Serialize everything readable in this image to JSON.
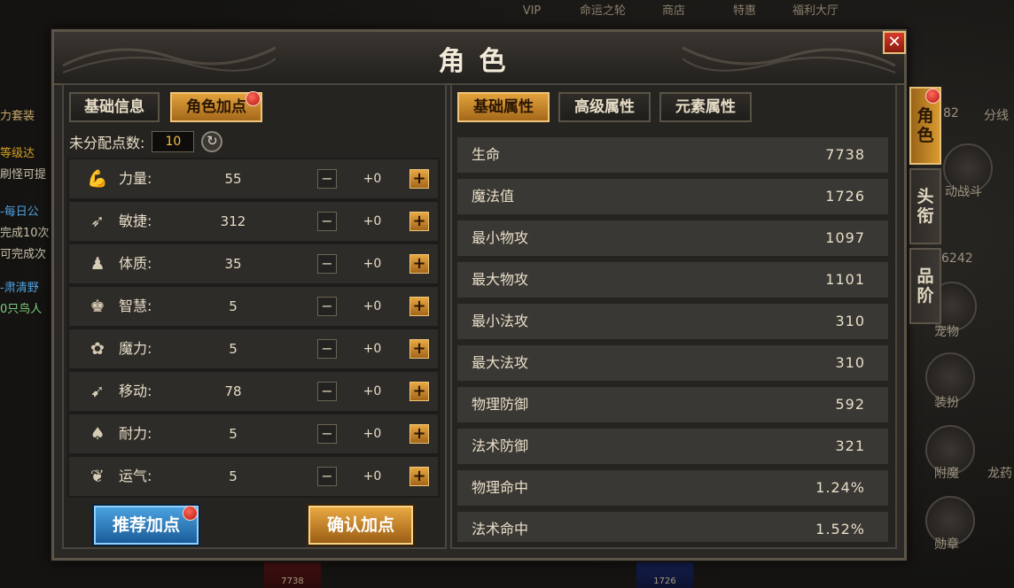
{
  "top_nav": [
    "VIP",
    "命运之轮",
    "商店",
    "特惠",
    "福利大厅"
  ],
  "left_side_texts": [
    {
      "text": "力套装",
      "color": "#c8a86a"
    },
    {
      "text": "等级达",
      "color": "#d4a020"
    },
    {
      "text": "刷怪可提",
      "color": "#c8c0a8"
    },
    {
      "text": "-每日公",
      "color": "#4fa0e0"
    },
    {
      "text": "完成10次",
      "color": "#c8c0a8"
    },
    {
      "text": "可完成次",
      "color": "#c8c0a8"
    },
    {
      "text": "-肃清野",
      "color": "#4fa0e0"
    },
    {
      "text": "0只鸟人",
      "color": "#7ed07e"
    }
  ],
  "right_side": {
    "top_values": [
      "82",
      "分线"
    ],
    "labels": [
      "动战斗",
      "6242",
      "宠物",
      "装扮",
      "附魔",
      "龙药",
      "勋章"
    ]
  },
  "bottom_slots": [
    "7738",
    "1726"
  ],
  "window": {
    "title": "角色",
    "close_label": "✕"
  },
  "side_tabs": [
    "角色",
    "头衔",
    "品阶"
  ],
  "left_tabs": [
    "基础信息",
    "角色加点"
  ],
  "unassigned": {
    "label": "未分配点数:",
    "value": "10",
    "reset_icon": "↻"
  },
  "attributes": [
    {
      "name": "力量:",
      "value": "55",
      "bonus": "+0",
      "icon": "💪"
    },
    {
      "name": "敏捷:",
      "value": "312",
      "bonus": "+0",
      "icon": "➶"
    },
    {
      "name": "体质:",
      "value": "35",
      "bonus": "+0",
      "icon": "♟"
    },
    {
      "name": "智慧:",
      "value": "5",
      "bonus": "+0",
      "icon": "♚"
    },
    {
      "name": "魔力:",
      "value": "5",
      "bonus": "+0",
      "icon": "✿"
    },
    {
      "name": "移动:",
      "value": "78",
      "bonus": "+0",
      "icon": "➹"
    },
    {
      "name": "耐力:",
      "value": "5",
      "bonus": "+0",
      "icon": "♠"
    },
    {
      "name": "运气:",
      "value": "5",
      "bonus": "+0",
      "icon": "❦"
    }
  ],
  "minus_label": "−",
  "plus_label": "+",
  "buttons": {
    "recommend": "推荐加点",
    "confirm": "确认加点"
  },
  "right_tabs": [
    "基础属性",
    "高级属性",
    "元素属性"
  ],
  "stats": [
    {
      "name": "生命",
      "value": "7738"
    },
    {
      "name": "魔法值",
      "value": "1726"
    },
    {
      "name": "最小物攻",
      "value": "1097"
    },
    {
      "name": "最大物攻",
      "value": "1101"
    },
    {
      "name": "最小法攻",
      "value": "310"
    },
    {
      "name": "最大法攻",
      "value": "310"
    },
    {
      "name": "物理防御",
      "value": "592"
    },
    {
      "name": "法术防御",
      "value": "321"
    },
    {
      "name": "物理命中",
      "value": "1.24%"
    },
    {
      "name": "法术命中",
      "value": "1.52%"
    }
  ]
}
